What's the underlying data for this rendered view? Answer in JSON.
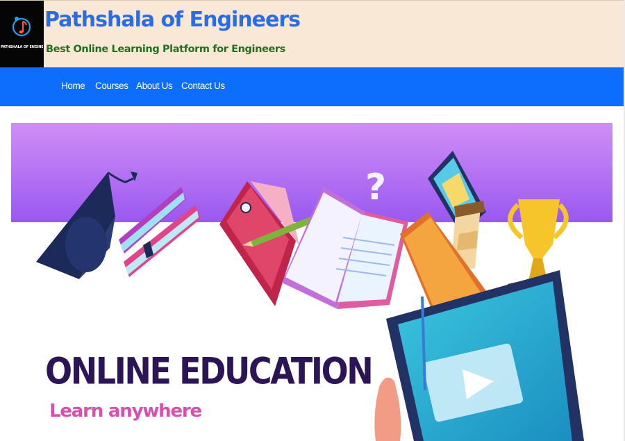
{
  "header": {
    "logo_text": "PATHSHALA OF ENGINEERS",
    "title": "Pathshala of Engineers",
    "tagline": "Best Online Learning Platform for Engineers"
  },
  "nav": {
    "items": [
      {
        "label": "Home"
      },
      {
        "label": "Courses"
      },
      {
        "label": "About Us"
      },
      {
        "label": "Contact Us"
      }
    ]
  },
  "banner": {
    "title": "ONLINE EDUCATION",
    "subtitle": "Learn anywhere"
  },
  "colors": {
    "header_bg": "#fae8d7",
    "title": "#2c6ce3",
    "tagline": "#207020",
    "nav_bg": "#0d6efd",
    "banner_top": "#cf8cf5",
    "banner_title": "#2b1555",
    "banner_subtitle": "#d84fb0"
  },
  "icons": [
    "music-note-logo-icon",
    "graduation-cap-icon",
    "books-icon",
    "notebook-icon",
    "open-book-icon",
    "pencil-icon",
    "question-mark-icon",
    "phone-icon",
    "coffee-cup-icon",
    "trophy-icon",
    "tablet-icon",
    "play-icon",
    "folder-icon"
  ]
}
